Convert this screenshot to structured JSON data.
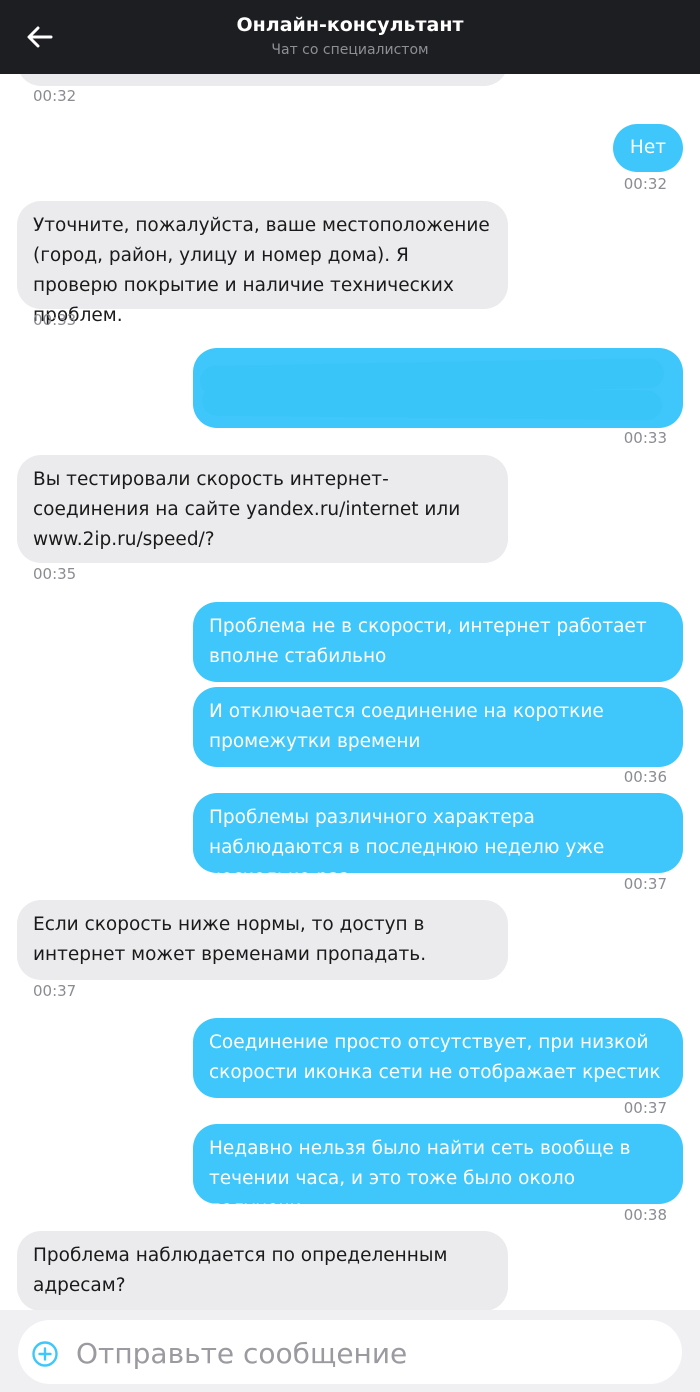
{
  "header": {
    "title": "Онлайн-консультант",
    "subtitle": "Чат со специалистом"
  },
  "icons": {
    "back": "arrow-left-icon",
    "attach": "plus-circle-icon"
  },
  "colors": {
    "header_bg": "#1d1e22",
    "incoming_bubble": "#ebebee",
    "outgoing_bubble": "#3fc7fb",
    "timestamp": "#8b8c92"
  },
  "messages": [
    {
      "sender": "operator",
      "text": "",
      "time": "00:32"
    },
    {
      "sender": "user",
      "text": "Нет",
      "time": "00:32"
    },
    {
      "sender": "operator",
      "text": "Уточните, пожалуйста, ваше местоположение (город, район, улицу и номер дома). Я проверю покрытие и наличие технических проблем.",
      "time": "00:33"
    },
    {
      "sender": "user",
      "text": "",
      "time": "00:33"
    },
    {
      "sender": "operator",
      "text": "Вы тестировали скорость интернет-соединения на сайте yandex.ru/internet или www.2ip.ru/speed/?",
      "time": "00:35"
    },
    {
      "sender": "user",
      "text": "Проблема не в скорости, интернет работает вполне стабильно",
      "time": ""
    },
    {
      "sender": "user",
      "text": "И отключается соединение на короткие промежутки времени",
      "time": "00:36"
    },
    {
      "sender": "user",
      "text": "Проблемы различного характера наблюдаются в последнюю неделю уже несколько раз",
      "time": "00:37"
    },
    {
      "sender": "operator",
      "text": "Если скорость ниже нормы, то доступ в интернет может временами пропадать.",
      "time": "00:37"
    },
    {
      "sender": "user",
      "text": "Соединение просто отсутствует, при низкой скорости иконка сети не отображает крестик",
      "time": "00:37"
    },
    {
      "sender": "user",
      "text": "Недавно нельзя было найти сеть вообще в течении часа, и это тоже было около полуночи",
      "time": "00:38"
    },
    {
      "sender": "operator",
      "text": "Проблема наблюдается по определенным адресам?",
      "time": ""
    }
  ],
  "composer": {
    "placeholder": "Отправьте сообщение"
  }
}
